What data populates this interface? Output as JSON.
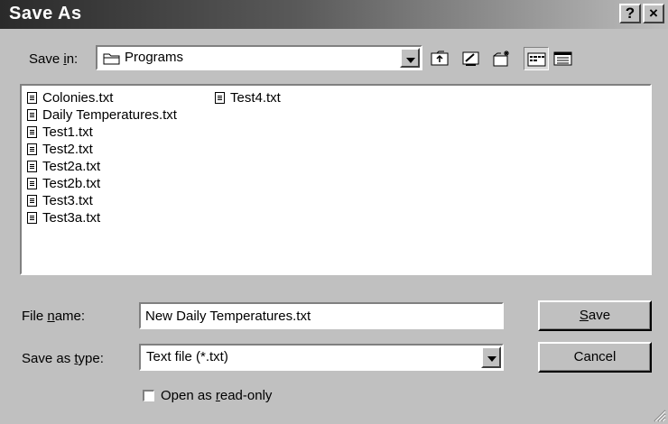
{
  "window": {
    "title": "Save As",
    "help_button": "?",
    "close_button": "×"
  },
  "save_in": {
    "label_pre": "Save ",
    "label_accel": "i",
    "label_post": "n:",
    "value": "Programs"
  },
  "toolbar": {
    "icons": [
      "up-one-level-icon",
      "desktop-icon",
      "new-folder-icon",
      "list-view-icon",
      "details-view-icon"
    ]
  },
  "files": [
    "Colonies.txt",
    "Daily Temperatures.txt",
    "Test1.txt",
    "Test2.txt",
    "Test2a.txt",
    "Test2b.txt",
    "Test3.txt",
    "Test3a.txt",
    "Test4.txt"
  ],
  "file_name": {
    "label_pre": "File ",
    "label_accel": "n",
    "label_post": "ame:",
    "value": "New Daily Temperatures.txt"
  },
  "save_as_type": {
    "label_pre": "Save as ",
    "label_accel": "t",
    "label_post": "ype:",
    "value": "Text file (*.txt)"
  },
  "read_only": {
    "label_pre": "Open as ",
    "label_accel": "r",
    "label_post": "ead-only",
    "checked": false
  },
  "buttons": {
    "save": {
      "accel": "S",
      "rest": "ave"
    },
    "cancel": "Cancel"
  }
}
